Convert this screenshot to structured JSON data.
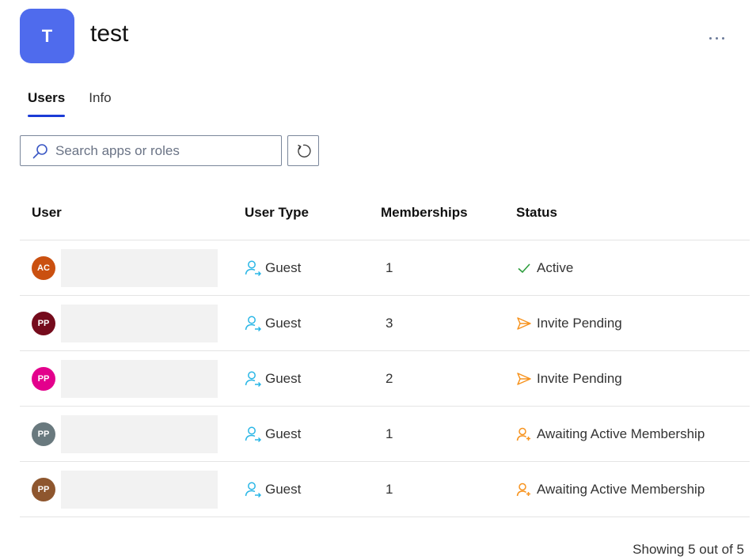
{
  "header": {
    "avatar_initial": "T",
    "avatar_color": "#4f6bed",
    "title": "test",
    "more_icon": "ellipsis-icon"
  },
  "tabs": [
    {
      "label": "Users",
      "active": true
    },
    {
      "label": "Info",
      "active": false
    }
  ],
  "search": {
    "placeholder": "Search apps or roles",
    "value": "",
    "icon": "search-icon"
  },
  "refresh": {
    "icon": "refresh-icon"
  },
  "table": {
    "columns": [
      "User",
      "User Type",
      "Memberships",
      "Status"
    ],
    "rows": [
      {
        "initials": "AC",
        "avatar_color": "#ca5010",
        "name": "",
        "user_type": "Guest",
        "memberships": "1",
        "status": "Active",
        "status_icon": "check-icon",
        "status_color": "#2e9e3e"
      },
      {
        "initials": "PP",
        "avatar_color": "#750b1c",
        "name": "",
        "user_type": "Guest",
        "memberships": "3",
        "status": "Invite Pending",
        "status_icon": "send-icon",
        "status_color": "#f7931e"
      },
      {
        "initials": "PP",
        "avatar_color": "#e3008c",
        "name": "",
        "user_type": "Guest",
        "memberships": "2",
        "status": "Invite Pending",
        "status_icon": "send-icon",
        "status_color": "#f7931e"
      },
      {
        "initials": "PP",
        "avatar_color": "#69797e",
        "name": "",
        "user_type": "Guest",
        "memberships": "1",
        "status": "Awaiting Active Membership",
        "status_icon": "person-add-icon",
        "status_color": "#f7931e"
      },
      {
        "initials": "PP",
        "avatar_color": "#8e562e",
        "name": "",
        "user_type": "Guest",
        "memberships": "1",
        "status": "Awaiting Active Membership",
        "status_icon": "person-add-icon",
        "status_color": "#f7931e"
      }
    ]
  },
  "footer": {
    "showing_text": "Showing 5 out of 5"
  },
  "colors": {
    "accent": "#1b3bd6",
    "guest_icon": "#29b6e6"
  }
}
